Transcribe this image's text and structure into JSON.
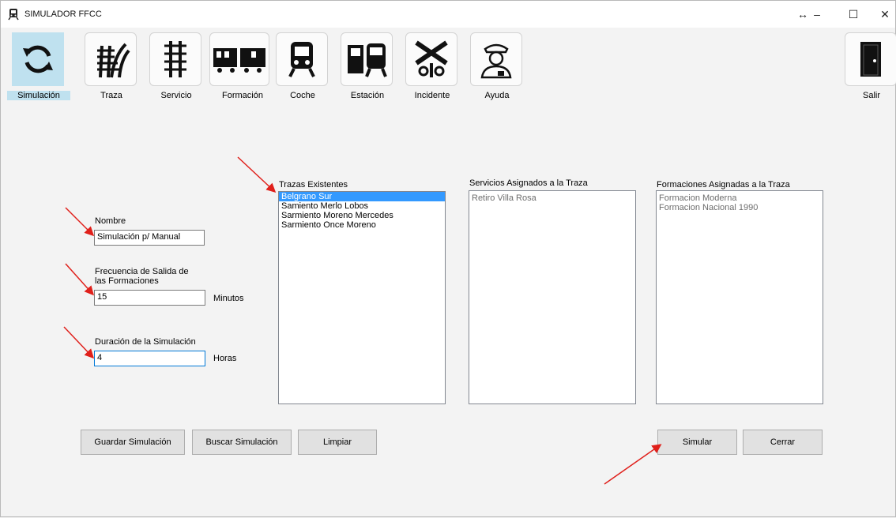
{
  "window": {
    "title": "SIMULADOR FFCC"
  },
  "toolbar": {
    "items": [
      {
        "label": "Simulación"
      },
      {
        "label": "Traza"
      },
      {
        "label": "Servicio"
      },
      {
        "label": "Formación"
      },
      {
        "label": "Coche"
      },
      {
        "label": "Estación"
      },
      {
        "label": "Incidente"
      },
      {
        "label": "Ayuda"
      }
    ],
    "exit_label": "Salir"
  },
  "form": {
    "nombre": {
      "label": "Nombre",
      "value": "Simulación p/ Manual"
    },
    "frecuencia": {
      "label_line1": "Frecuencia de Salida de",
      "label_line2": "las Formaciones",
      "value": "15",
      "unit": "Minutos"
    },
    "duracion": {
      "label": "Duración de la Simulación",
      "value": "4",
      "unit": "Horas"
    }
  },
  "lists": {
    "trazas": {
      "label": "Trazas Existentes",
      "items": [
        "Belgrano Sur",
        "Samiento Merlo Lobos",
        "Sarmiento Moreno Mercedes",
        "Sarmiento Once Moreno"
      ]
    },
    "servicios": {
      "label": "Servicios Asignados a la Traza",
      "items": [
        "Retiro Villa Rosa"
      ]
    },
    "formaciones": {
      "label": "Formaciones Asignadas a la Traza",
      "items": [
        "Formacion Moderna",
        "Formacion Nacional 1990"
      ]
    }
  },
  "buttons": {
    "guardar": "Guardar Simulación",
    "buscar": "Buscar Simulación",
    "limpiar": "Limpiar",
    "simular": "Simular",
    "cerrar": "Cerrar"
  },
  "colors": {
    "selection": "#3399ff",
    "active_tool": "#bfe1ef",
    "annotation_arrow": "#e0201b"
  }
}
